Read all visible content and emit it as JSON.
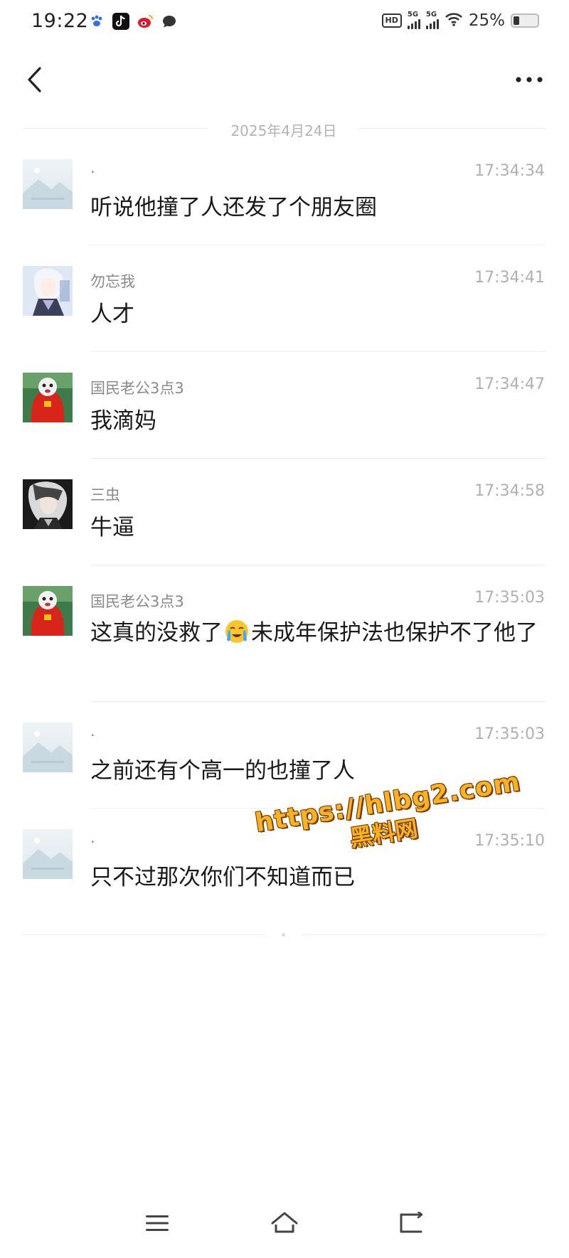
{
  "status_bar": {
    "time": "19:22",
    "network_label_1": "HD",
    "signal_label_1": "5G",
    "signal_label_2": "5G",
    "battery": "25%",
    "battery_level": 0.25
  },
  "header": {
    "back_icon": "chevron-left-icon",
    "more_icon": "more-horizontal-icon"
  },
  "date_divider": "2025年4月24日",
  "messages": [
    {
      "sender": "·",
      "time": "17:34:34",
      "text": "听说他撞了人还发了个朋友圈",
      "avatar": "placeholder"
    },
    {
      "sender": "勿忘我",
      "time": "17:34:41",
      "text": "人才",
      "avatar": "anime-girl"
    },
    {
      "sender": "国民老公3点3",
      "time": "17:34:47",
      "text": "我滴妈",
      "avatar": "red-costume"
    },
    {
      "sender": "三虫",
      "time": "17:34:58",
      "text": "牛逼",
      "avatar": "dark-character"
    },
    {
      "sender": "国民老公3点3",
      "time": "17:35:03",
      "text_part1": "这真的没救了",
      "text_part2": "未成年保护法也保护不了他了",
      "avatar": "red-costume"
    },
    {
      "sender": "·",
      "time": "17:35:03",
      "text": "之前还有个高一的也撞了人",
      "avatar": "placeholder"
    },
    {
      "sender": "·",
      "time": "17:35:10",
      "text": "只不过那次你们不知道而已",
      "avatar": "placeholder"
    }
  ],
  "watermark": {
    "url": "https://hlbg2.com",
    "label": "黑料网"
  },
  "nav_bar": {
    "menu_icon": "menu-icon",
    "home_icon": "home-icon",
    "back_icon": "back-icon"
  }
}
